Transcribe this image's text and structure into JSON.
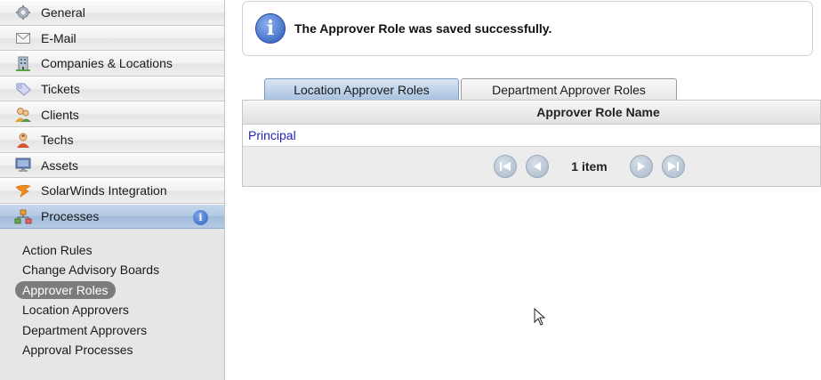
{
  "sidebar": {
    "items": [
      {
        "label": "General",
        "icon": "gear-icon"
      },
      {
        "label": "E-Mail",
        "icon": "envelope-icon"
      },
      {
        "label": "Companies & Locations",
        "icon": "building-icon"
      },
      {
        "label": "Tickets",
        "icon": "tag-icon"
      },
      {
        "label": "Clients",
        "icon": "clients-icon"
      },
      {
        "label": "Techs",
        "icon": "tech-user-icon"
      },
      {
        "label": "Assets",
        "icon": "monitor-icon"
      },
      {
        "label": "SolarWinds Integration",
        "icon": "solarwinds-icon"
      },
      {
        "label": "Processes",
        "icon": "processes-icon"
      }
    ],
    "subitems": [
      {
        "label": "Action Rules"
      },
      {
        "label": "Change Advisory Boards"
      },
      {
        "label": "Approver Roles"
      },
      {
        "label": "Location Approvers"
      },
      {
        "label": "Department Approvers"
      },
      {
        "label": "Approval Processes"
      }
    ]
  },
  "notice": {
    "message": "The Approver Role was saved successfully."
  },
  "tabs": [
    {
      "label": "Location Approver Roles"
    },
    {
      "label": "Department Approver Roles"
    }
  ],
  "grid": {
    "header": "Approver Role Name",
    "rows": [
      {
        "name": "Principal"
      }
    ],
    "pager_count": "1 item"
  }
}
